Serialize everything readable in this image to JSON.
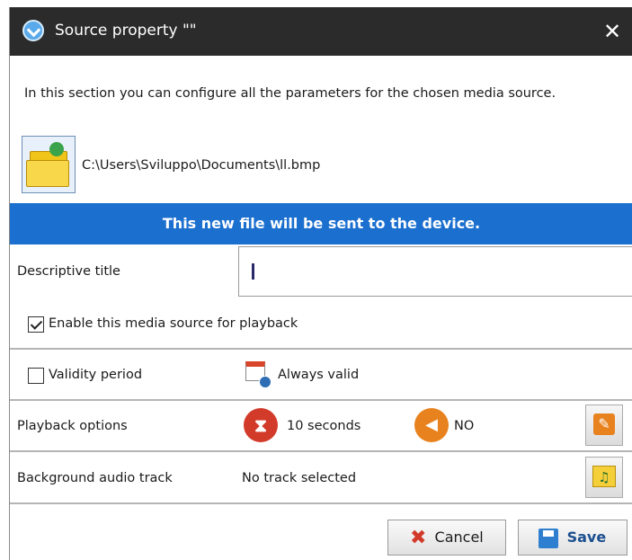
{
  "window": {
    "title": "Source property \"\"",
    "close_glyph": "✕",
    "app_icon": "app-logo-icon"
  },
  "intro_text": "In this section you can configure all the parameters for the chosen media source.",
  "file": {
    "path": "C:\\Users\\Sviluppo\\Documents\\ll.bmp",
    "browse_icon": "folder-icon"
  },
  "banner": {
    "text": "This new file will be sent to the device.",
    "color": "#1b6fcf"
  },
  "descriptive_title": {
    "label": "Descriptive title",
    "value": ""
  },
  "enable_playback": {
    "label": "Enable this media source for playback",
    "checked": true
  },
  "validity": {
    "label": "Validity period",
    "checked": false,
    "status": "Always valid",
    "icon": "calendar-clock-icon"
  },
  "playback": {
    "label": "Playback options",
    "duration": "10 seconds",
    "duration_icon": "hourglass-icon",
    "audio": "NO",
    "audio_icon": "speaker-icon",
    "settings_icon": "wrench-icon"
  },
  "background_audio": {
    "label": "Background audio track",
    "value": "No track selected",
    "icon": "music-folder-icon"
  },
  "buttons": {
    "cancel": "Cancel",
    "save": "Save"
  },
  "colors": {
    "titlebar": "#2b2b2b",
    "accent_red": "#d23a2a",
    "accent_orange": "#e8821e"
  }
}
